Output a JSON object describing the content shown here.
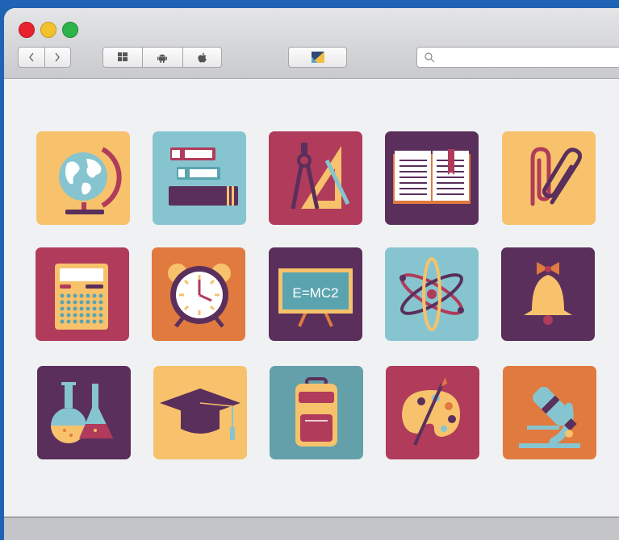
{
  "window": {
    "traffic_lights": {
      "close": "#e8212e",
      "minimize": "#f2c12e",
      "zoom": "#2eb34a"
    },
    "nav": {
      "back_icon": "chevron-left-icon",
      "forward_icon": "chevron-right-icon"
    },
    "platforms": [
      "windows-icon",
      "android-icon",
      "apple-icon"
    ],
    "search": {
      "placeholder": ""
    }
  },
  "icons": [
    {
      "name": "globe",
      "bg": "#f7c26b"
    },
    {
      "name": "books",
      "bg": "#86c5d0"
    },
    {
      "name": "compass-ruler",
      "bg": "#b03b5a"
    },
    {
      "name": "open-book",
      "bg": "#5a2f5c"
    },
    {
      "name": "paperclip",
      "bg": "#f7c26b"
    },
    {
      "name": "calculator",
      "bg": "#b03b5a"
    },
    {
      "name": "alarm-clock",
      "bg": "#e07a3f"
    },
    {
      "name": "chalkboard",
      "bg": "#5a2f5c",
      "text": "E=MC2"
    },
    {
      "name": "atom",
      "bg": "#86c5d0"
    },
    {
      "name": "bell",
      "bg": "#5a2f5c"
    },
    {
      "name": "flasks",
      "bg": "#5a2f5c"
    },
    {
      "name": "graduation-cap",
      "bg": "#f7c26b"
    },
    {
      "name": "backpack",
      "bg": "#64a0aa"
    },
    {
      "name": "paint-palette",
      "bg": "#b03b5a"
    },
    {
      "name": "microscope",
      "bg": "#e07a3f"
    }
  ]
}
